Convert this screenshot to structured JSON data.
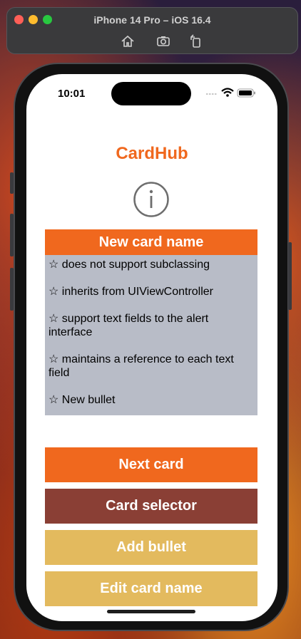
{
  "simulator": {
    "title": "iPhone 14 Pro – iOS 16.4",
    "toolbar_icons": [
      "home-icon",
      "camera-icon",
      "rotate-icon"
    ]
  },
  "status_bar": {
    "time": "10:01",
    "icons": [
      "cellular-icon",
      "wifi-icon",
      "battery-icon"
    ]
  },
  "app": {
    "title": "CardHub",
    "title_color": "#f0681e",
    "info_icon": "info-icon"
  },
  "card": {
    "name": "New card name",
    "bullets": [
      "☆ does not support subclassing",
      "☆ inherits from UIViewController",
      "☆ support text fields to the alert interface",
      "☆ maintains a reference to each text field",
      "☆ New bullet"
    ]
  },
  "buttons": {
    "next_card": "Next card",
    "card_selector": "Card selector",
    "add_bullet": "Add bullet",
    "edit_card_name": "Edit card name"
  },
  "colors": {
    "accent_orange": "#f0681e",
    "brown": "#8a3f35",
    "gold": "#e3ba5e",
    "card_background": "#b8bcc7"
  }
}
